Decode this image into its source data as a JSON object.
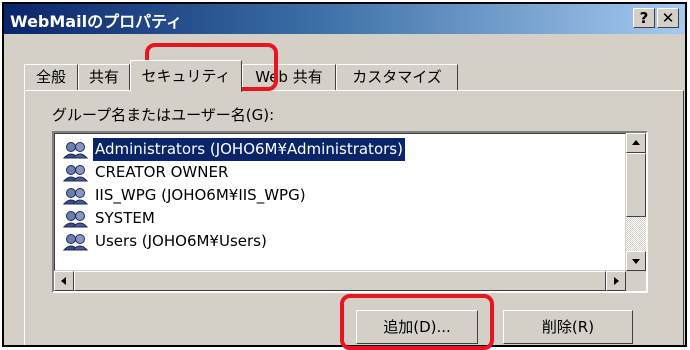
{
  "window": {
    "title": "WebMailのプロパティ",
    "help_button": "?",
    "close_button": "✕"
  },
  "tabs": [
    {
      "label": "全般"
    },
    {
      "label": "共有"
    },
    {
      "label": "セキュリティ",
      "active": true
    },
    {
      "label": "Web 共有"
    },
    {
      "label": "カスタマイズ"
    }
  ],
  "security": {
    "group_label": "グループ名またはユーザー名(G):",
    "users": [
      {
        "name": "Administrators (JOHO6M¥Administrators)",
        "icon": "group-icon",
        "selected": true
      },
      {
        "name": "CREATOR OWNER",
        "icon": "group-icon"
      },
      {
        "name": "IIS_WPG (JOHO6M¥IIS_WPG)",
        "icon": "group-icon"
      },
      {
        "name": "SYSTEM",
        "icon": "group-icon"
      },
      {
        "name": "Users (JOHO6M¥Users)",
        "icon": "group-icon"
      }
    ],
    "add_button": "追加(D)...",
    "remove_button": "削除(R)"
  },
  "colors": {
    "title_bar": "#0a246a",
    "selection": "#0a246a",
    "highlight": "#e8141e",
    "face": "#d4d0c8"
  }
}
